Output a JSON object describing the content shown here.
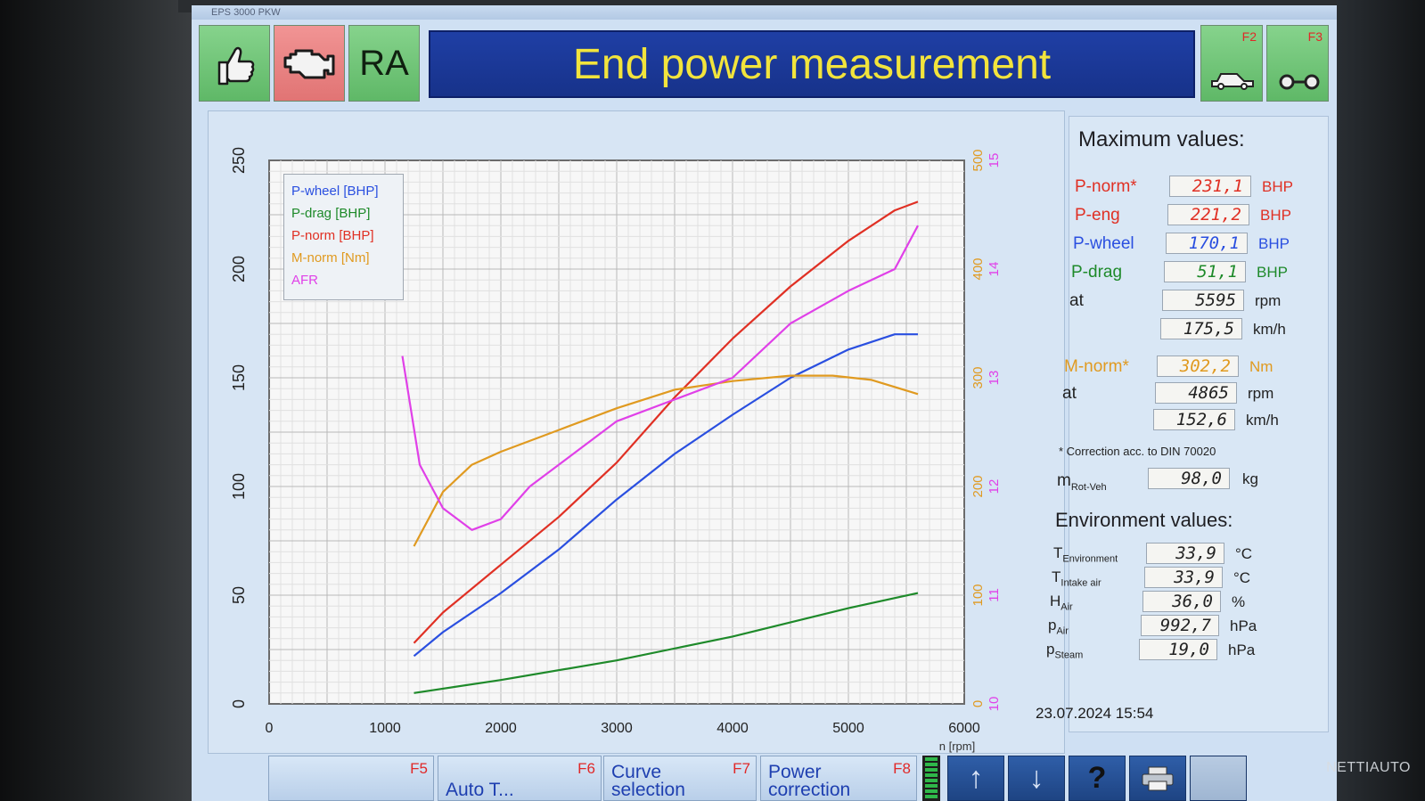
{
  "window": {
    "title": "EPS 3000 PKW"
  },
  "header": {
    "title": "End power measurement",
    "ra_label": "RA",
    "f2": "F2",
    "f3": "F3"
  },
  "legend": [
    "P-wheel [BHP]",
    "P-drag [BHP]",
    "P-norm [BHP]",
    "M-norm [Nm]",
    "AFR"
  ],
  "max_values": {
    "title": "Maximum values:",
    "p_norm": {
      "label": "P-norm*",
      "value": "231,1",
      "unit": "BHP"
    },
    "p_eng": {
      "label": "P-eng",
      "value": "221,2",
      "unit": "BHP"
    },
    "p_wheel": {
      "label": "P-wheel",
      "value": "170,1",
      "unit": "BHP"
    },
    "p_drag": {
      "label": "P-drag",
      "value": "51,1",
      "unit": "BHP"
    },
    "at_label": "at",
    "p_rpm": {
      "value": "5595",
      "unit": "rpm"
    },
    "p_speed": {
      "value": "175,5",
      "unit": "km/h"
    },
    "m_norm": {
      "label": "M-norm*",
      "value": "302,2",
      "unit": "Nm"
    },
    "m_rpm": {
      "value": "4865",
      "unit": "rpm"
    },
    "m_speed": {
      "value": "152,6",
      "unit": "km/h"
    },
    "correction_note": "* Correction acc. to DIN 70020",
    "m_rot": {
      "label": "m",
      "sub": "Rot-Veh",
      "value": "98,0",
      "unit": "kg"
    }
  },
  "environment": {
    "title": "Environment values:",
    "rows": [
      {
        "label": "T",
        "sub": "Environment",
        "value": "33,9",
        "unit": "°C"
      },
      {
        "label": "T",
        "sub": "Intake air",
        "value": "33,9",
        "unit": "°C"
      },
      {
        "label": "H",
        "sub": "Air",
        "value": "36,0",
        "unit": "%"
      },
      {
        "label": "p",
        "sub": "Air",
        "value": "992,7",
        "unit": "hPa"
      },
      {
        "label": "p",
        "sub": "Steam",
        "value": "19,0",
        "unit": "hPa"
      }
    ]
  },
  "timestamp": "23.07.2024   15:54",
  "bottom_bar": {
    "f5": "F5",
    "f6": "F6",
    "f7": "F7",
    "f8": "F8",
    "f6_label": "Auto T...",
    "f7_label": "Curve selection",
    "f8_label": "Power correction",
    "up_icon": "↑",
    "down_icon": "↓",
    "help_icon": "?"
  },
  "watermark": "NETTIAUTO",
  "colors": {
    "p_wheel": "#2a4fe0",
    "p_drag": "#1e8a2a",
    "p_norm": "#e03024",
    "m_norm": "#e09a20",
    "afr": "#e040e8",
    "title_bg": "#1f3fa5",
    "title_text": "#f2e43c"
  },
  "chart_data": {
    "type": "line",
    "xlabel": "n [rpm]",
    "xlim": [
      0,
      6000
    ],
    "ylim": [
      0,
      250
    ],
    "x_ticks": [
      0,
      1000,
      2000,
      3000,
      4000,
      5000,
      6000
    ],
    "y_ticks": [
      0,
      50,
      100,
      150,
      200,
      250
    ],
    "right_axis_torque": {
      "ylim": [
        0,
        500
      ],
      "ticks": [
        0,
        100,
        200,
        300,
        400,
        500
      ]
    },
    "right_axis_afr": {
      "ylim": [
        10,
        15
      ],
      "ticks": [
        10,
        11,
        12,
        13,
        14,
        15
      ]
    },
    "series": [
      {
        "name": "P-norm [BHP]",
        "axis": "power",
        "x": [
          1250,
          1500,
          2000,
          2500,
          3000,
          3500,
          4000,
          4500,
          5000,
          5400,
          5600
        ],
        "values": [
          28,
          42,
          64,
          86,
          111,
          141,
          168,
          192,
          213,
          227,
          231
        ]
      },
      {
        "name": "P-wheel [BHP]",
        "axis": "power",
        "x": [
          1250,
          1500,
          2000,
          2500,
          3000,
          3500,
          4000,
          4500,
          5000,
          5400,
          5600
        ],
        "values": [
          22,
          33,
          51,
          71,
          94,
          115,
          133,
          150,
          163,
          170,
          170
        ]
      },
      {
        "name": "P-drag [BHP]",
        "axis": "power",
        "x": [
          1250,
          2000,
          3000,
          4000,
          5000,
          5600
        ],
        "values": [
          5,
          11,
          20,
          31,
          44,
          51
        ]
      },
      {
        "name": "M-norm [Nm]",
        "axis": "torque",
        "x": [
          1250,
          1500,
          1750,
          2000,
          2500,
          3000,
          3500,
          4000,
          4500,
          4865,
          5200,
          5600
        ],
        "values": [
          145,
          195,
          220,
          232,
          252,
          272,
          289,
          297,
          302,
          302,
          298,
          285
        ]
      },
      {
        "name": "AFR",
        "axis": "afr",
        "x": [
          1150,
          1300,
          1500,
          1750,
          2000,
          2250,
          2500,
          3000,
          3500,
          4000,
          4500,
          5000,
          5400,
          5600
        ],
        "values": [
          13.2,
          12.2,
          11.8,
          11.6,
          11.7,
          12.0,
          12.2,
          12.6,
          12.8,
          13.0,
          13.5,
          13.8,
          14.0,
          14.4
        ]
      }
    ]
  }
}
